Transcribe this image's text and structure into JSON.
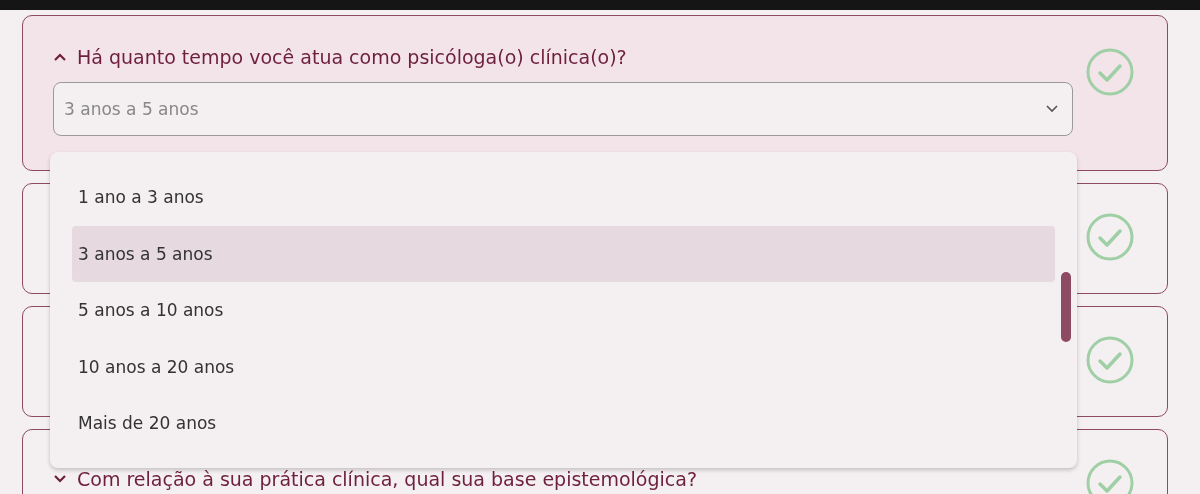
{
  "questions": [
    {
      "question": "Há quanto tempo você atua como psicóloga(o) clínica(o)?",
      "expanded": true,
      "answered": true,
      "select": {
        "value": "3 anos a 5 anos",
        "open": true,
        "options": [
          {
            "label": "1 ano a 3 anos",
            "selected": false
          },
          {
            "label": "3 anos a 5 anos",
            "selected": true
          },
          {
            "label": "5 anos a 10 anos",
            "selected": false
          },
          {
            "label": "10 anos a 20 anos",
            "selected": false
          },
          {
            "label": "Mais de 20 anos",
            "selected": false
          }
        ]
      }
    },
    {
      "answered": true
    },
    {
      "answered": true
    },
    {
      "question": "Com relação à sua prática clínica, qual sua base epistemológica?",
      "expanded": false,
      "answered": true
    }
  ]
}
